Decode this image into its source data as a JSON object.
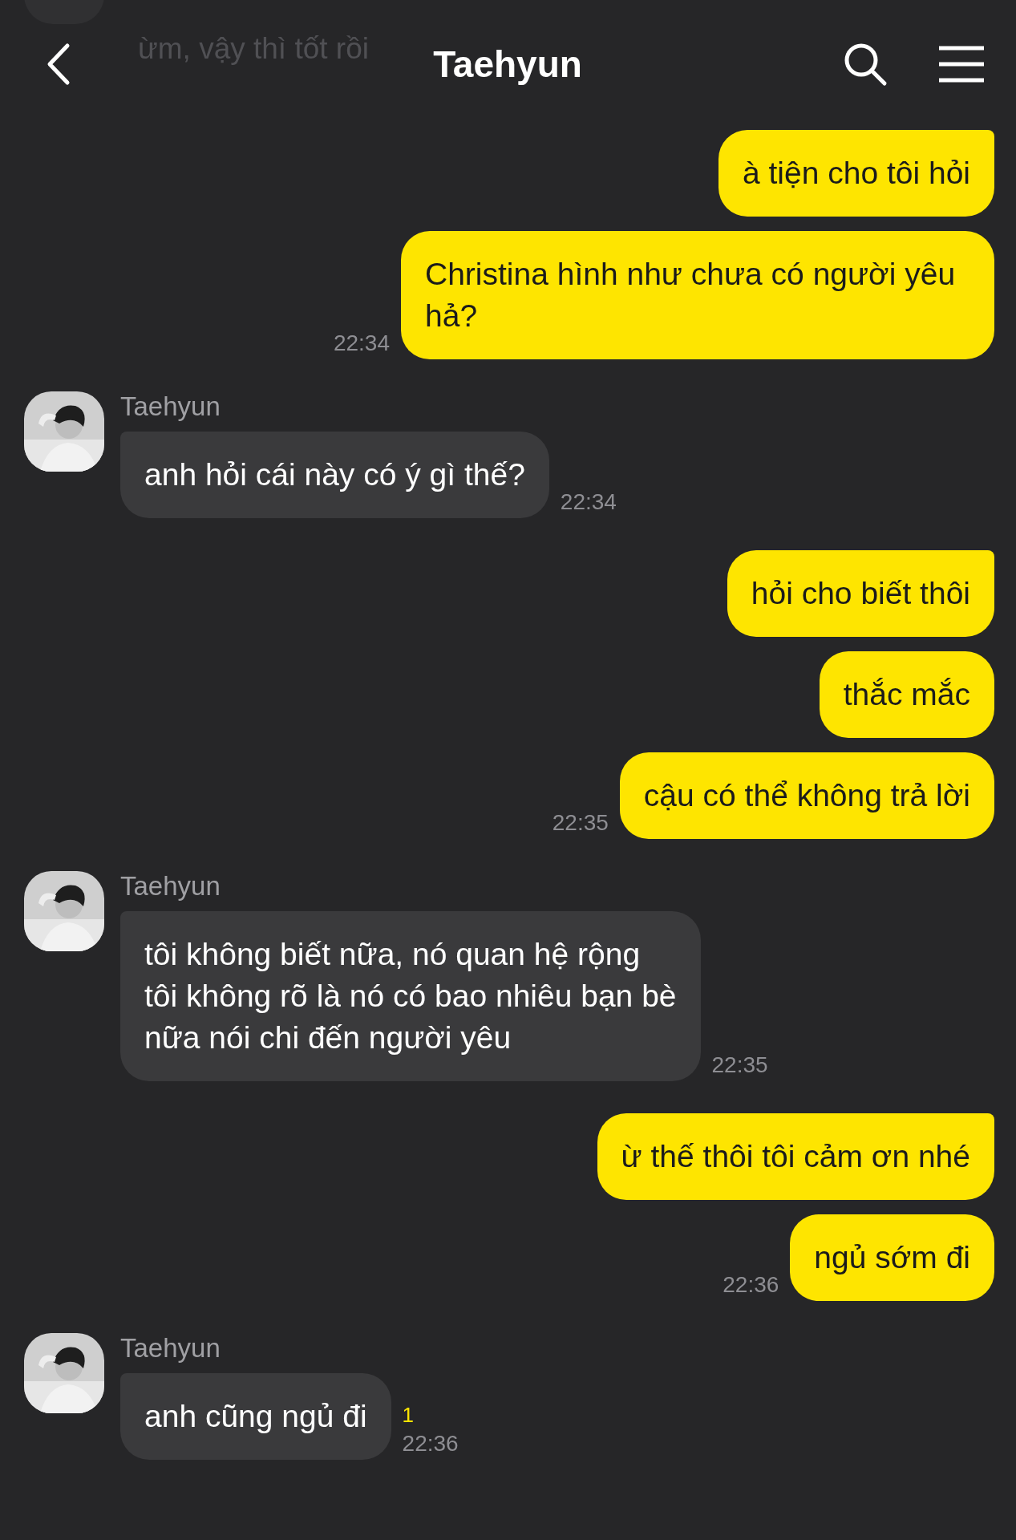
{
  "header": {
    "title": "Taehyun",
    "faded_message": "ừm, vậy thì tốt rồi"
  },
  "groups": [
    {
      "kind": "sent",
      "messages": [
        "à tiện cho tôi hỏi",
        "Christina hình như chưa có người yêu hả?"
      ],
      "time": "22:34"
    },
    {
      "kind": "received",
      "sender": "Taehyun",
      "messages": [
        "anh hỏi cái này có ý gì thế?"
      ],
      "time": "22:34"
    },
    {
      "kind": "sent",
      "messages": [
        "hỏi cho biết thôi",
        "thắc mắc",
        "cậu có thể không trả lời"
      ],
      "time": "22:35"
    },
    {
      "kind": "received",
      "sender": "Taehyun",
      "messages": [
        "tôi không biết nữa, nó quan hệ rộng\ntôi không rõ là nó có bao nhiêu bạn bè\nnữa nói chi đến người yêu"
      ],
      "time": "22:35"
    },
    {
      "kind": "sent",
      "messages": [
        "ừ thế thôi tôi cảm ơn nhé",
        "ngủ sớm đi"
      ],
      "time": "22:36"
    },
    {
      "kind": "received",
      "sender": "Taehyun",
      "messages": [
        "anh cũng ngủ đi"
      ],
      "time": "22:36",
      "unread": "1"
    }
  ]
}
